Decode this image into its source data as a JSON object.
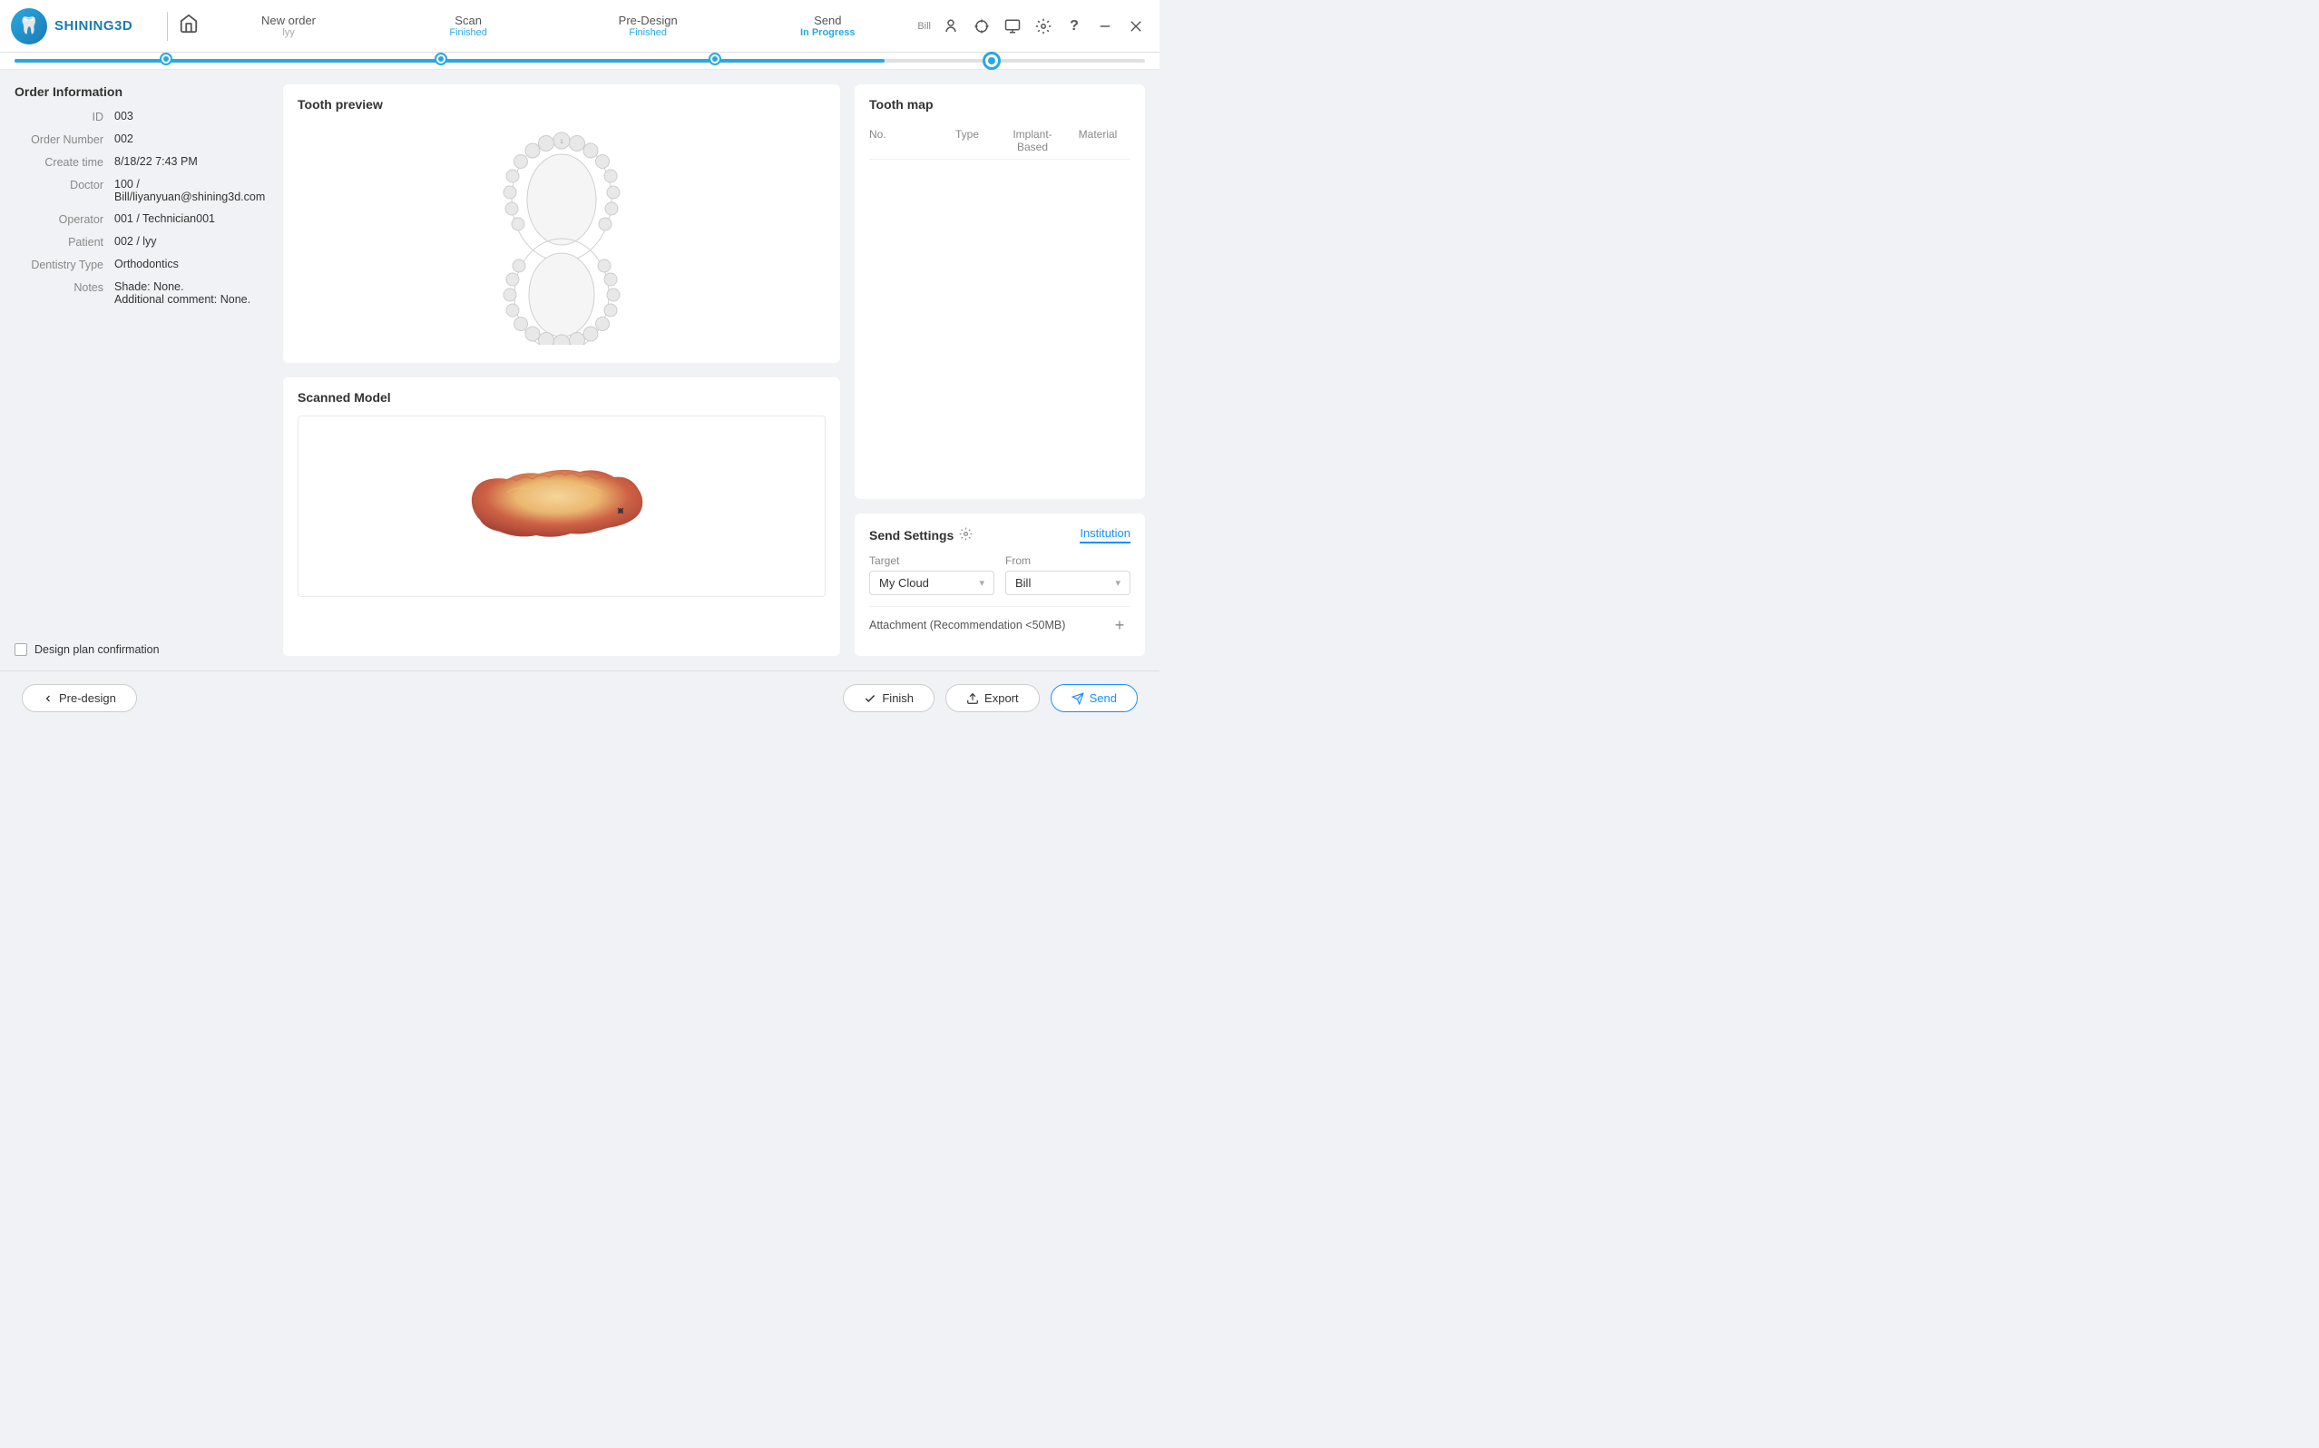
{
  "app": {
    "title": "SHINING3D",
    "home_icon": "🏠"
  },
  "steps": [
    {
      "id": "new-order",
      "label": "New order",
      "sub": "lyy",
      "sub_type": "user"
    },
    {
      "id": "scan",
      "label": "Scan",
      "sub": "Finished",
      "sub_type": "finished"
    },
    {
      "id": "pre-design",
      "label": "Pre-Design",
      "sub": "Finished",
      "sub_type": "finished"
    },
    {
      "id": "send",
      "label": "Send",
      "sub": "In Progress",
      "sub_type": "inprogress"
    }
  ],
  "right_icons": {
    "bill_label": "Bill",
    "badge_label": "Help"
  },
  "order_info": {
    "title": "Order Information",
    "fields": [
      {
        "label": "ID",
        "value": "003"
      },
      {
        "label": "Order Number",
        "value": "002"
      },
      {
        "label": "Create time",
        "value": "8/18/22 7:43 PM"
      },
      {
        "label": "Doctor",
        "value": "100 / Bill/liyanyuan@shining3d.com"
      },
      {
        "label": "Operator",
        "value": "001 / Technician001"
      },
      {
        "label": "Patient",
        "value": "002 / lyy"
      },
      {
        "label": "Dentistry Type",
        "value": "Orthodontics"
      },
      {
        "label": "Notes",
        "value": "Shade: None.\nAdditional comment: None."
      }
    ],
    "design_confirm_label": "Design plan confirmation"
  },
  "tooth_preview": {
    "title": "Tooth preview"
  },
  "scanned_model": {
    "title": "Scanned Model"
  },
  "tooth_map": {
    "title": "Tooth map",
    "columns": [
      "No.",
      "Type",
      "Implant-Based",
      "Material"
    ]
  },
  "send_settings": {
    "title": "Send Settings",
    "tab_label": "Institution",
    "target_label": "Target",
    "target_value": "My Cloud",
    "from_label": "From",
    "from_value": "Bill",
    "attachment_label": "Attachment (Recommendation <50MB)"
  },
  "bottom_bar": {
    "pre_design_btn": "Pre-design",
    "finish_btn": "Finish",
    "export_btn": "Export",
    "send_btn": "Send"
  }
}
